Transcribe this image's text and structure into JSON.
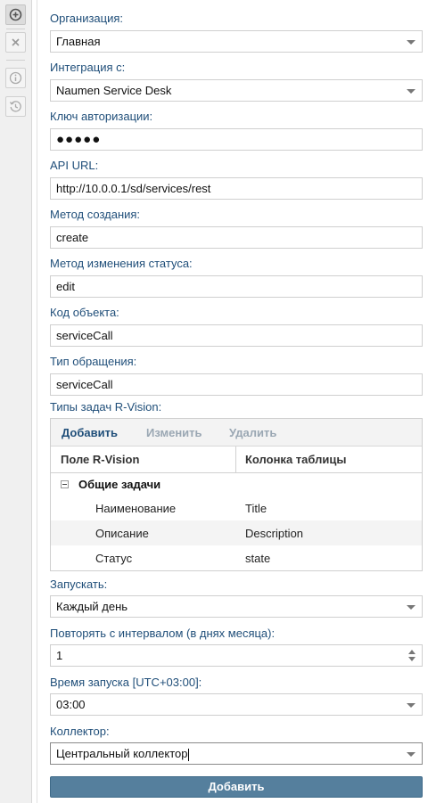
{
  "toolbar": {
    "items": [
      {
        "icon": "add-circle-icon",
        "state": "active"
      },
      {
        "icon": "close-icon",
        "state": "normal"
      },
      {
        "icon": "info-icon",
        "state": "normal"
      },
      {
        "icon": "history-icon",
        "state": "normal"
      }
    ]
  },
  "form": {
    "organization": {
      "label": "Организация:",
      "value": "Главная"
    },
    "integration": {
      "label": "Интеграция с:",
      "value": "Naumen Service Desk"
    },
    "auth_key": {
      "label": "Ключ авторизации:",
      "value": "●●●●●"
    },
    "api_url": {
      "label": "API URL:",
      "value": "http://10.0.0.1/sd/services/rest"
    },
    "create_method": {
      "label": "Метод создания:",
      "value": "create"
    },
    "status_method": {
      "label": "Метод изменения статуса:",
      "value": "edit"
    },
    "object_code": {
      "label": "Код объекта:",
      "value": "serviceCall"
    },
    "request_type": {
      "label": "Тип обращения:",
      "value": "serviceCall"
    },
    "task_types": {
      "label": "Типы задач R-Vision:",
      "toolbar": {
        "add": "Добавить",
        "edit": "Изменить",
        "delete": "Удалить"
      },
      "columns": [
        "Поле R-Vision",
        "Колонка таблицы"
      ],
      "group": "Общие задачи",
      "rows": [
        {
          "field": "Наименование",
          "column": "Title"
        },
        {
          "field": "Описание",
          "column": "Description"
        },
        {
          "field": "Статус",
          "column": "state"
        }
      ]
    },
    "run": {
      "label": "Запускать:",
      "value": "Каждый день"
    },
    "repeat": {
      "label": "Повторять с интервалом (в днях месяца):",
      "value": "1"
    },
    "start_time": {
      "label": "Время запуска [UTC+03:00]:",
      "value": "03:00"
    },
    "collector": {
      "label": "Коллектор:",
      "value": "Центральный коллектор"
    },
    "submit": "Добавить"
  },
  "colors": {
    "label": "#1f4e79",
    "button": "#557f9d",
    "toolbar_bg": "#f0f0f0"
  }
}
